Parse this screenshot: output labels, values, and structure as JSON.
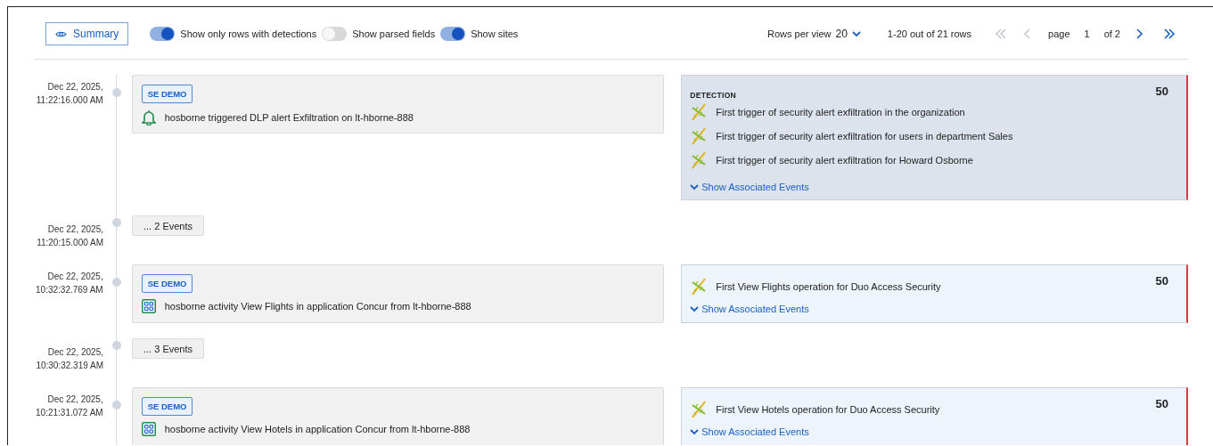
{
  "toolbar": {
    "summary_button": "Summary",
    "toggles": [
      {
        "label": "Show only rows with detections",
        "on": true
      },
      {
        "label": "Show parsed fields",
        "on": false
      },
      {
        "label": "Show sites",
        "on": true
      }
    ],
    "rows_per_view": {
      "label": "Rows per view",
      "value": "20"
    },
    "range": "1-20 out of 21 rows",
    "pager": {
      "first_disabled": true,
      "prev_disabled": true,
      "page_label": "page",
      "page": "1",
      "of": "of 2",
      "next_disabled": false,
      "last_disabled": false
    }
  },
  "timeline": [
    {
      "kind": "alert_event",
      "date": "Dec 22, 2025,",
      "time": "11:22:16.000 AM",
      "badge": "SE DEMO",
      "text": "hosborne triggered DLP alert Exfiltration on lt-hborne-888",
      "detection": {
        "selected": true,
        "heading": "DETECTION",
        "score": "50",
        "items": [
          "First trigger of security alert exfiltration in the organization",
          "First trigger of security alert exfiltration for users in department Sales",
          "First trigger of security alert exfiltration for Howard Osborne"
        ],
        "link": "Show Associated Events"
      }
    },
    {
      "kind": "collapsed",
      "date": "Dec 22, 2025,",
      "time": "11:20:15.000 AM",
      "label": "... 2 Events"
    },
    {
      "kind": "app_event",
      "date": "Dec 22, 2025,",
      "time": "10:32:32.769 AM",
      "badge": "SE DEMO",
      "text": "hosborne activity View Flights in application Concur from lt-hborne-888",
      "detection": {
        "selected": false,
        "score": "50",
        "items": [
          "First View Flights operation for Duo Access Security"
        ],
        "link": "Show Associated Events"
      }
    },
    {
      "kind": "collapsed",
      "date": "Dec 22, 2025,",
      "time": "10:30:32.319 AM",
      "label": "... 3 Events"
    },
    {
      "kind": "app_event",
      "date": "Dec 22, 2025,",
      "time": "10:21:31.072 AM",
      "badge": "SE DEMO",
      "text": "hosborne activity View Hotels in application Concur from lt-hborne-888",
      "detection": {
        "selected": false,
        "score": "50",
        "items": [
          "First View Hotels operation for Duo Access Security"
        ],
        "link": "Show Associated Events"
      }
    }
  ]
}
